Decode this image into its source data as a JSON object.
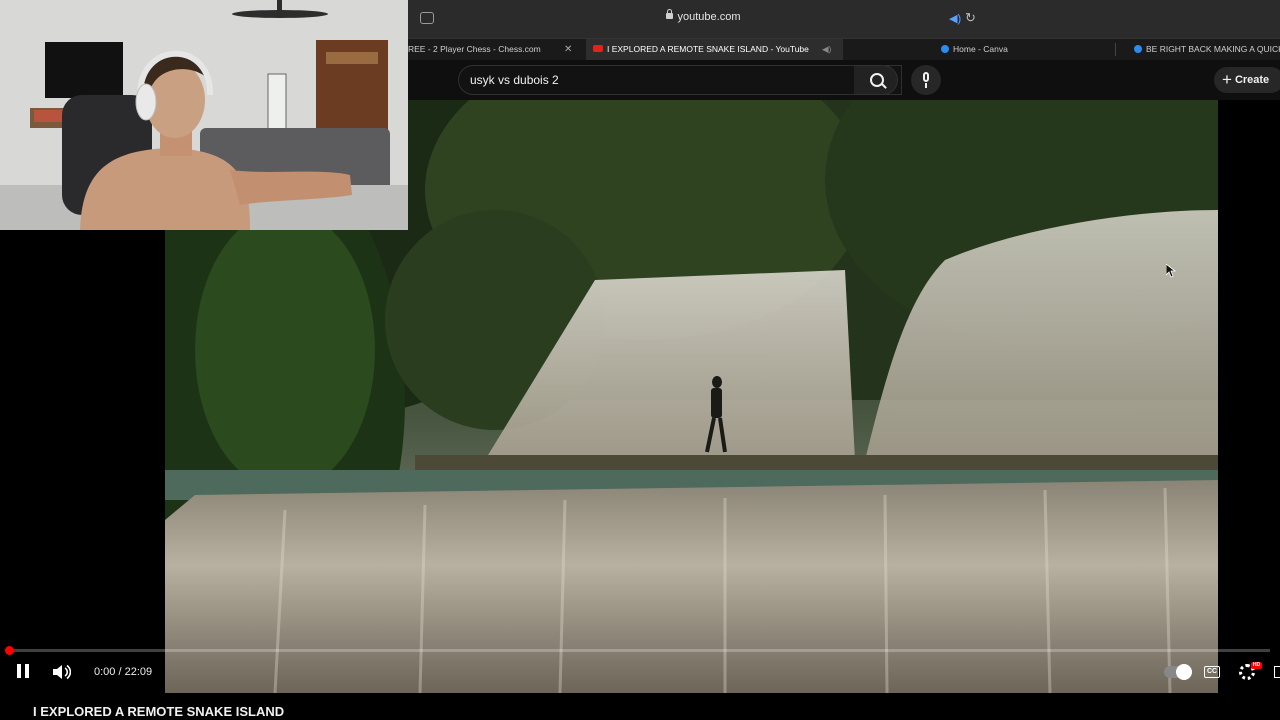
{
  "browser": {
    "url": "youtube.com",
    "tabs": [
      {
        "label": "REE - 2 Player Chess - Chess.com"
      },
      {
        "label": "I EXPLORED A REMOTE SNAKE ISLAND - YouTube",
        "active": true
      },
      {
        "label": "Home - Canva"
      },
      {
        "label": "BE RIGHT BACK MAKING A QUICK"
      }
    ]
  },
  "youtube": {
    "search_query": "usyk vs dubois 2",
    "create_label": "Create"
  },
  "player": {
    "time_display": "0:00 / 22:09",
    "progress_fraction": 0.001,
    "hd_badge": "HD",
    "cc_label": "CC"
  },
  "video": {
    "title": "I EXPLORED A REMOTE SNAKE ISLAND"
  },
  "colors": {
    "youtube_red": "#ff0000",
    "background": "#0f0f0f",
    "canva_blue": "#2b8cf0"
  }
}
